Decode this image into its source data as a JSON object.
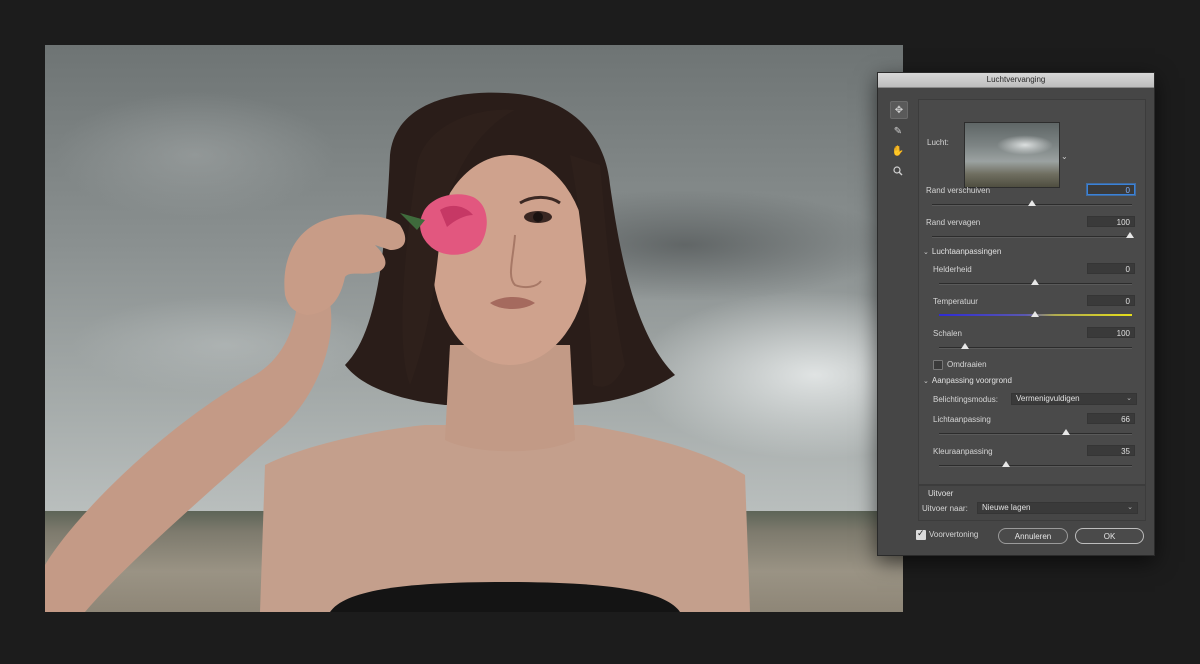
{
  "dialog": {
    "title": "Luchtvervanging",
    "tools": [
      "move-icon",
      "sky-brush-icon",
      "hand-icon",
      "zoom-icon"
    ],
    "sky": {
      "label": "Lucht:"
    },
    "sliders": [
      {
        "label": "Rand verschuiven",
        "value": "0",
        "position": 0.5
      },
      {
        "label": "Rand vervagen",
        "value": "100",
        "position": 1.0
      }
    ],
    "sky_adjustments": {
      "title": "Luchtaanpassingen",
      "sliders": [
        {
          "label": "Helderheid",
          "value": "0",
          "position": 0.5
        },
        {
          "label": "Temperatuur",
          "value": "0",
          "position": 0.5
        },
        {
          "label": "Schalen",
          "value": "100",
          "position": 0.14
        }
      ],
      "flip_label": "Omdraaien",
      "flip_checked": false
    },
    "foreground": {
      "title": "Aanpassing voorgrond",
      "blend_label": "Belichtingsmodus:",
      "blend_value": "Vermenigvuldigen",
      "sliders": [
        {
          "label": "Lichtaanpassing",
          "value": "66",
          "position": 0.66
        },
        {
          "label": "Kleuraanpassing",
          "value": "35",
          "position": 0.35
        }
      ]
    },
    "output": {
      "title": "Uitvoer",
      "to_label": "Uitvoer naar:",
      "to_value": "Nieuwe lagen"
    },
    "preview_label": "Voorvertoning",
    "preview_checked": true,
    "cancel_label": "Annuleren",
    "ok_label": "OK"
  },
  "colors": {
    "app_bg": "#1c1c1c",
    "dialog_bg": "#464646",
    "focus": "#3b82d8"
  }
}
